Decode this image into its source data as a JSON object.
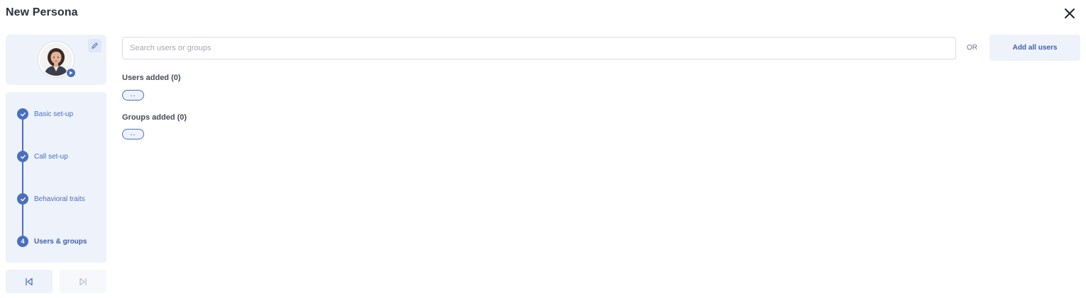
{
  "dialog": {
    "title": "New Persona"
  },
  "icons": {
    "close": "close-icon",
    "edit": "pencil-icon",
    "play": "play-icon",
    "check": "check-icon",
    "prev": "skip-back-icon",
    "next": "skip-forward-icon"
  },
  "colors": {
    "accent": "#4a6fbf",
    "panel_bg": "#eef2fa",
    "title_text": "#2c303b"
  },
  "steps": [
    {
      "label": "Basic set-up",
      "status": "complete",
      "marker": ""
    },
    {
      "label": "Call set-up",
      "status": "complete",
      "marker": ""
    },
    {
      "label": "Behavioral traits",
      "status": "complete",
      "marker": ""
    },
    {
      "label": "Users & groups",
      "status": "active",
      "marker": "4"
    }
  ],
  "search": {
    "placeholder": "Search users or groups",
    "value": ""
  },
  "or_label": "OR",
  "add_all_label": "Add all users",
  "users_section": {
    "title": "Users added (0)",
    "empty_chip": "--"
  },
  "groups_section": {
    "title": "Groups added (0)",
    "empty_chip": "--"
  }
}
